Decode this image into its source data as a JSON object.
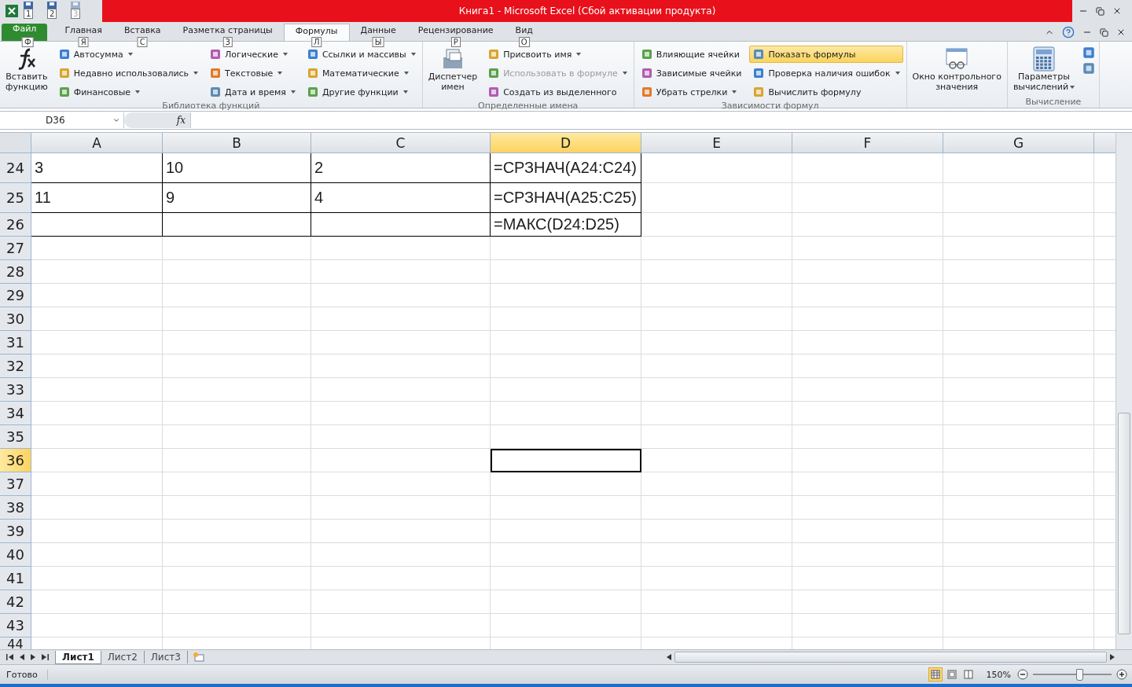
{
  "window": {
    "title": "Книга1  -  Microsoft Excel (Сбой активации продукта)"
  },
  "quick_access": [
    {
      "keytip": "1",
      "disabled": false
    },
    {
      "keytip": "2",
      "disabled": false
    },
    {
      "keytip": "3",
      "disabled": true
    }
  ],
  "tabs": [
    {
      "label": "Файл",
      "keytip": "Ф",
      "kind": "file",
      "selected": false
    },
    {
      "label": "Главная",
      "keytip": "Я",
      "kind": "tab",
      "selected": false
    },
    {
      "label": "Вставка",
      "keytip": "С",
      "kind": "tab",
      "selected": false
    },
    {
      "label": "Разметка страницы",
      "keytip": "З",
      "kind": "tab",
      "selected": false
    },
    {
      "label": "Формулы",
      "keytip": "Л",
      "kind": "tab",
      "selected": true
    },
    {
      "label": "Данные",
      "keytip": "Ы",
      "kind": "tab",
      "selected": false
    },
    {
      "label": "Рецензирование",
      "keytip": "Р",
      "kind": "tab",
      "selected": false
    },
    {
      "label": "Вид",
      "keytip": "О",
      "kind": "tab",
      "selected": false
    }
  ],
  "ribbon": [
    {
      "title": "Библиотека функций",
      "large": {
        "lines": [
          "Вставить",
          "функцию"
        ],
        "dropdown": false
      },
      "columns": [
        [
          {
            "label": "Автосумма",
            "dropdown": true,
            "disabled": false,
            "on": false
          },
          {
            "label": "Недавно использовались",
            "dropdown": true,
            "disabled": false,
            "on": false
          },
          {
            "label": "Финансовые",
            "dropdown": true,
            "disabled": false,
            "on": false
          }
        ],
        [
          {
            "label": "Логические",
            "dropdown": true,
            "disabled": false,
            "on": false
          },
          {
            "label": "Текстовые",
            "dropdown": true,
            "disabled": false,
            "on": false
          },
          {
            "label": "Дата и время",
            "dropdown": true,
            "disabled": false,
            "on": false
          }
        ],
        [
          {
            "label": "Ссылки и массивы",
            "dropdown": true,
            "disabled": false,
            "on": false
          },
          {
            "label": "Математические",
            "dropdown": true,
            "disabled": false,
            "on": false
          },
          {
            "label": "Другие функции",
            "dropdown": true,
            "disabled": false,
            "on": false
          }
        ]
      ]
    },
    {
      "title": "Определенные имена",
      "large": {
        "lines": [
          "Диспетчер",
          "имен"
        ],
        "dropdown": false
      },
      "columns": [
        [
          {
            "label": "Присвоить имя",
            "dropdown": true,
            "disabled": false,
            "on": false
          },
          {
            "label": "Использовать в формуле",
            "dropdown": true,
            "disabled": true,
            "on": false
          },
          {
            "label": "Создать из выделенного",
            "dropdown": false,
            "disabled": false,
            "on": false
          }
        ]
      ]
    },
    {
      "title": "Зависимости формул",
      "columns": [
        [
          {
            "label": "Влияющие ячейки",
            "dropdown": false,
            "disabled": false,
            "on": false
          },
          {
            "label": "Зависимые ячейки",
            "dropdown": false,
            "disabled": false,
            "on": false
          },
          {
            "label": "Убрать стрелки",
            "dropdown": true,
            "disabled": false,
            "on": false
          }
        ],
        [
          {
            "label": "Показать формулы",
            "dropdown": false,
            "disabled": false,
            "on": true
          },
          {
            "label": "Проверка наличия ошибок",
            "dropdown": true,
            "disabled": false,
            "on": false
          },
          {
            "label": "Вычислить формулу",
            "dropdown": false,
            "disabled": false,
            "on": false
          }
        ]
      ]
    },
    {
      "large": {
        "lines": [
          "Окно контрольного",
          "значения"
        ],
        "dropdown": false
      }
    },
    {
      "title": "Вычисление",
      "large": {
        "lines": [
          "Параметры",
          "вычислений"
        ],
        "dropdown": true
      },
      "icon_column": true
    }
  ],
  "formula_bar": {
    "name_box": "D36",
    "fx": "fx"
  },
  "columns": [
    {
      "label": "A",
      "selected": false
    },
    {
      "label": "B",
      "selected": false
    },
    {
      "label": "C",
      "selected": false
    },
    {
      "label": "D",
      "selected": true
    },
    {
      "label": "E",
      "selected": false
    },
    {
      "label": "F",
      "selected": false
    },
    {
      "label": "G",
      "selected": false
    }
  ],
  "rows": [
    {
      "number": "24",
      "selected": false,
      "bordered": true,
      "cells": [
        {
          "value": "3",
          "selected": false
        },
        {
          "value": "10",
          "selected": false
        },
        {
          "value": "2",
          "selected": false
        },
        {
          "value": "=СРЗНАЧ(A24:C24)",
          "selected": false
        }
      ]
    },
    {
      "number": "25",
      "selected": false,
      "bordered": true,
      "cells": [
        {
          "value": "11",
          "selected": false
        },
        {
          "value": "9",
          "selected": false
        },
        {
          "value": "4",
          "selected": false
        },
        {
          "value": "=СРЗНАЧ(A25:C25)",
          "selected": false
        }
      ]
    },
    {
      "number": "26",
      "selected": false,
      "bordered": true,
      "cells": [
        {
          "selected": false
        },
        {
          "selected": false
        },
        {
          "selected": false
        },
        {
          "value": "=МАКС(D24:D25)",
          "selected": false
        }
      ]
    },
    {
      "number": "27",
      "selected": false,
      "bordered": false
    },
    {
      "number": "28",
      "selected": false,
      "bordered": false
    },
    {
      "number": "29",
      "selected": false,
      "bordered": false
    },
    {
      "number": "30",
      "selected": false,
      "bordered": false
    },
    {
      "number": "31",
      "selected": false,
      "bordered": false
    },
    {
      "number": "32",
      "selected": false,
      "bordered": false
    },
    {
      "number": "33",
      "selected": false,
      "bordered": false
    },
    {
      "number": "34",
      "selected": false,
      "bordered": false
    },
    {
      "number": "35",
      "selected": false,
      "bordered": false
    },
    {
      "number": "36",
      "selected": true,
      "bordered": false,
      "cells": [
        {
          "selected": false
        },
        {
          "selected": false
        },
        {
          "selected": false
        },
        {
          "selected": true
        }
      ]
    },
    {
      "number": "37",
      "selected": false,
      "bordered": false
    },
    {
      "number": "38",
      "selected": false,
      "bordered": false
    },
    {
      "number": "39",
      "selected": false,
      "bordered": false
    },
    {
      "number": "40",
      "selected": false,
      "bordered": false
    },
    {
      "number": "41",
      "selected": false,
      "bordered": false
    },
    {
      "number": "42",
      "selected": false,
      "bordered": false
    },
    {
      "number": "43",
      "selected": false,
      "bordered": false
    },
    {
      "number": "44",
      "selected": false,
      "bordered": false
    }
  ],
  "sheets": [
    {
      "label": "Лист1",
      "selected": true
    },
    {
      "label": "Лист2",
      "selected": false
    },
    {
      "label": "Лист3",
      "selected": false
    }
  ],
  "status_bar": {
    "status": "Готово",
    "views": [
      {
        "selected": true
      },
      {
        "selected": false
      },
      {
        "selected": false
      }
    ],
    "zoom": "150%",
    "zoom_level": {
      "level": 0.58
    }
  }
}
